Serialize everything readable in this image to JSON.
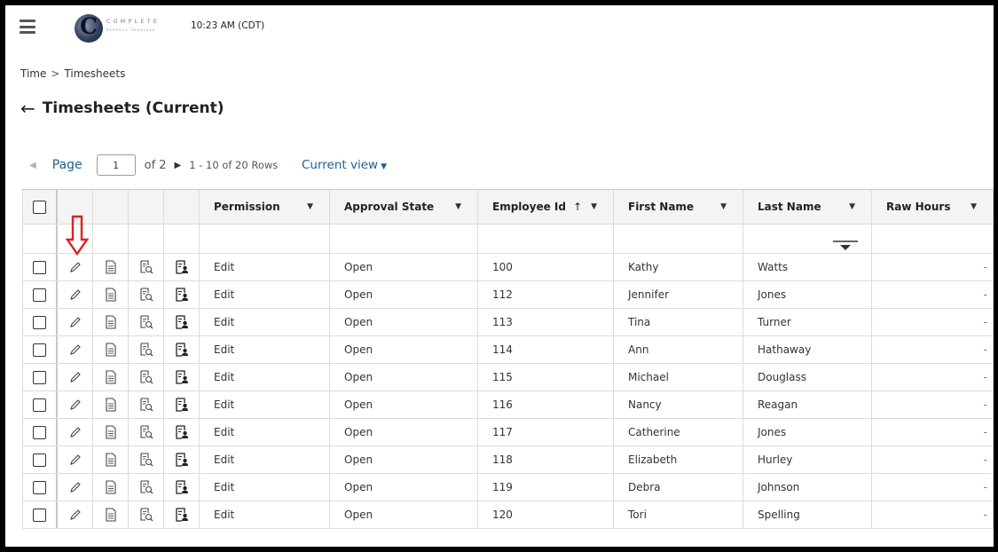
{
  "header": {
    "logo_word": "COMPLETE",
    "logo_sub": "PAYROLL SERVICES",
    "logo_letter": "C",
    "time": "10:23 AM (CDT)"
  },
  "breadcrumb": {
    "items": [
      "Time",
      "Timesheets"
    ],
    "separator": ">"
  },
  "page": {
    "title": "Timesheets (Current)"
  },
  "pager": {
    "label": "Page",
    "current": "1",
    "of_text": "of 2",
    "rows_text": "1 - 10 of 20 Rows",
    "view_label": "Current view"
  },
  "table": {
    "columns": [
      "Permission",
      "Approval State",
      "Employee Id",
      "First Name",
      "Last Name",
      "Raw Hours"
    ],
    "sort_column": "Employee Id",
    "sort_direction": "ascending",
    "rows": [
      {
        "permission": "Edit",
        "state": "Open",
        "id": "100",
        "first": "Kathy",
        "last": "Watts",
        "hours": "-"
      },
      {
        "permission": "Edit",
        "state": "Open",
        "id": "112",
        "first": "Jennifer",
        "last": "Jones",
        "hours": "-"
      },
      {
        "permission": "Edit",
        "state": "Open",
        "id": "113",
        "first": "Tina",
        "last": "Turner",
        "hours": "-"
      },
      {
        "permission": "Edit",
        "state": "Open",
        "id": "114",
        "first": "Ann",
        "last": "Hathaway",
        "hours": "-"
      },
      {
        "permission": "Edit",
        "state": "Open",
        "id": "115",
        "first": "Michael",
        "last": "Douglass",
        "hours": "-"
      },
      {
        "permission": "Edit",
        "state": "Open",
        "id": "116",
        "first": "Nancy",
        "last": "Reagan",
        "hours": "-"
      },
      {
        "permission": "Edit",
        "state": "Open",
        "id": "117",
        "first": "Catherine",
        "last": "Jones",
        "hours": "-"
      },
      {
        "permission": "Edit",
        "state": "Open",
        "id": "118",
        "first": "Elizabeth",
        "last": "Hurley",
        "hours": "-"
      },
      {
        "permission": "Edit",
        "state": "Open",
        "id": "119",
        "first": "Debra",
        "last": "Johnson",
        "hours": "-"
      },
      {
        "permission": "Edit",
        "state": "Open",
        "id": "120",
        "first": "Tori",
        "last": "Spelling",
        "hours": "-"
      }
    ]
  },
  "icons": {
    "row_actions": [
      "pencil-icon",
      "document-icon",
      "search-document-icon",
      "employee-document-icon"
    ],
    "annotation": "red-down-arrow-icon"
  },
  "colors": {
    "accent": "#1f5f8b",
    "annotation": "#e02020"
  }
}
